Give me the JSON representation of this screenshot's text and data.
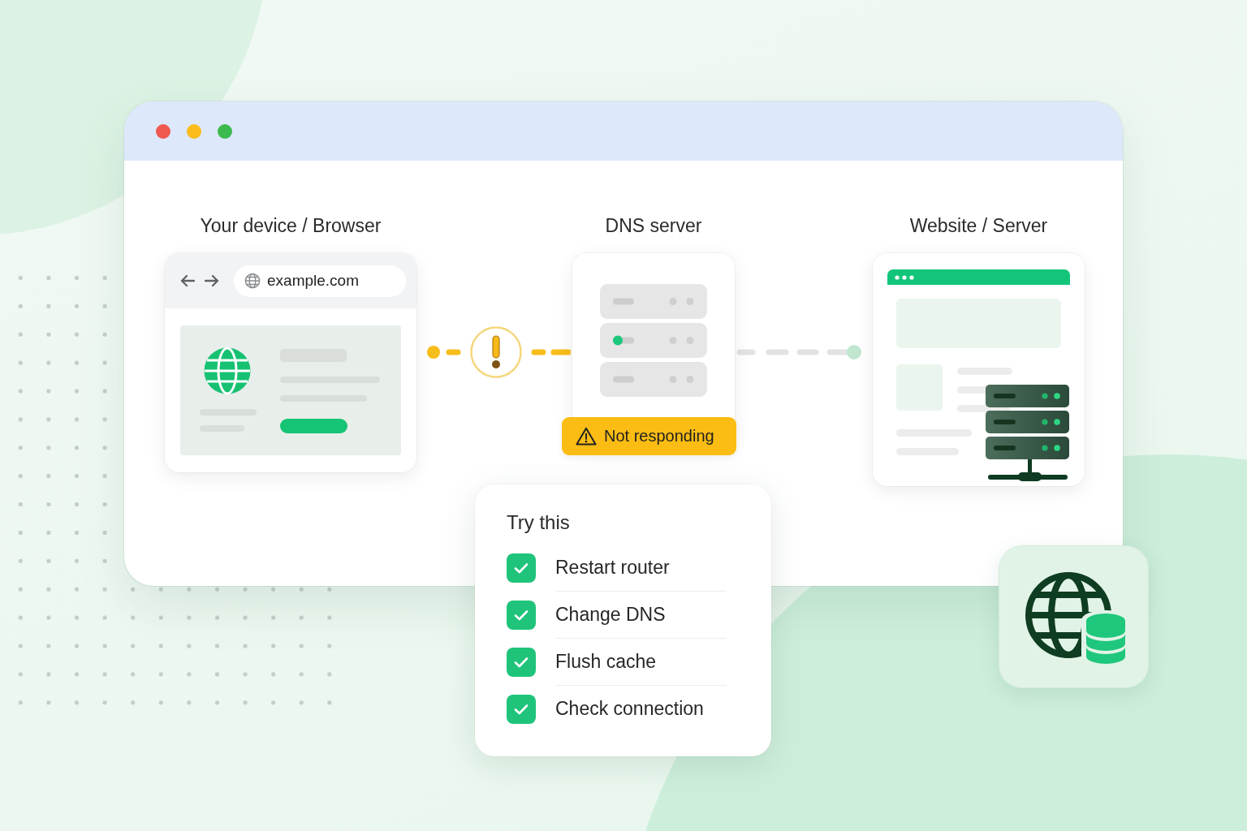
{
  "window": {
    "controls": [
      {
        "color": "#f0594f"
      },
      {
        "color": "#fbbc1c"
      },
      {
        "color": "#3dba4e"
      }
    ]
  },
  "nodes": [
    {
      "kind": "browser",
      "title": "Your device / Browser",
      "url": "example.com"
    },
    {
      "kind": "dns",
      "title": "DNS server",
      "units": [
        {
          "active": false
        },
        {
          "active": true
        },
        {
          "active": false
        }
      ],
      "status": "Not responding"
    },
    {
      "kind": "website",
      "title": "Website / Server"
    }
  ],
  "links": [
    {
      "warning": true
    },
    {
      "warning": false
    }
  ],
  "tips": {
    "title": "Try this",
    "items": [
      {
        "label": "Restart router",
        "checked": true
      },
      {
        "label": "Change DNS",
        "checked": true
      },
      {
        "label": "Flush cache",
        "checked": true
      },
      {
        "label": "Check connection",
        "checked": true
      }
    ]
  }
}
